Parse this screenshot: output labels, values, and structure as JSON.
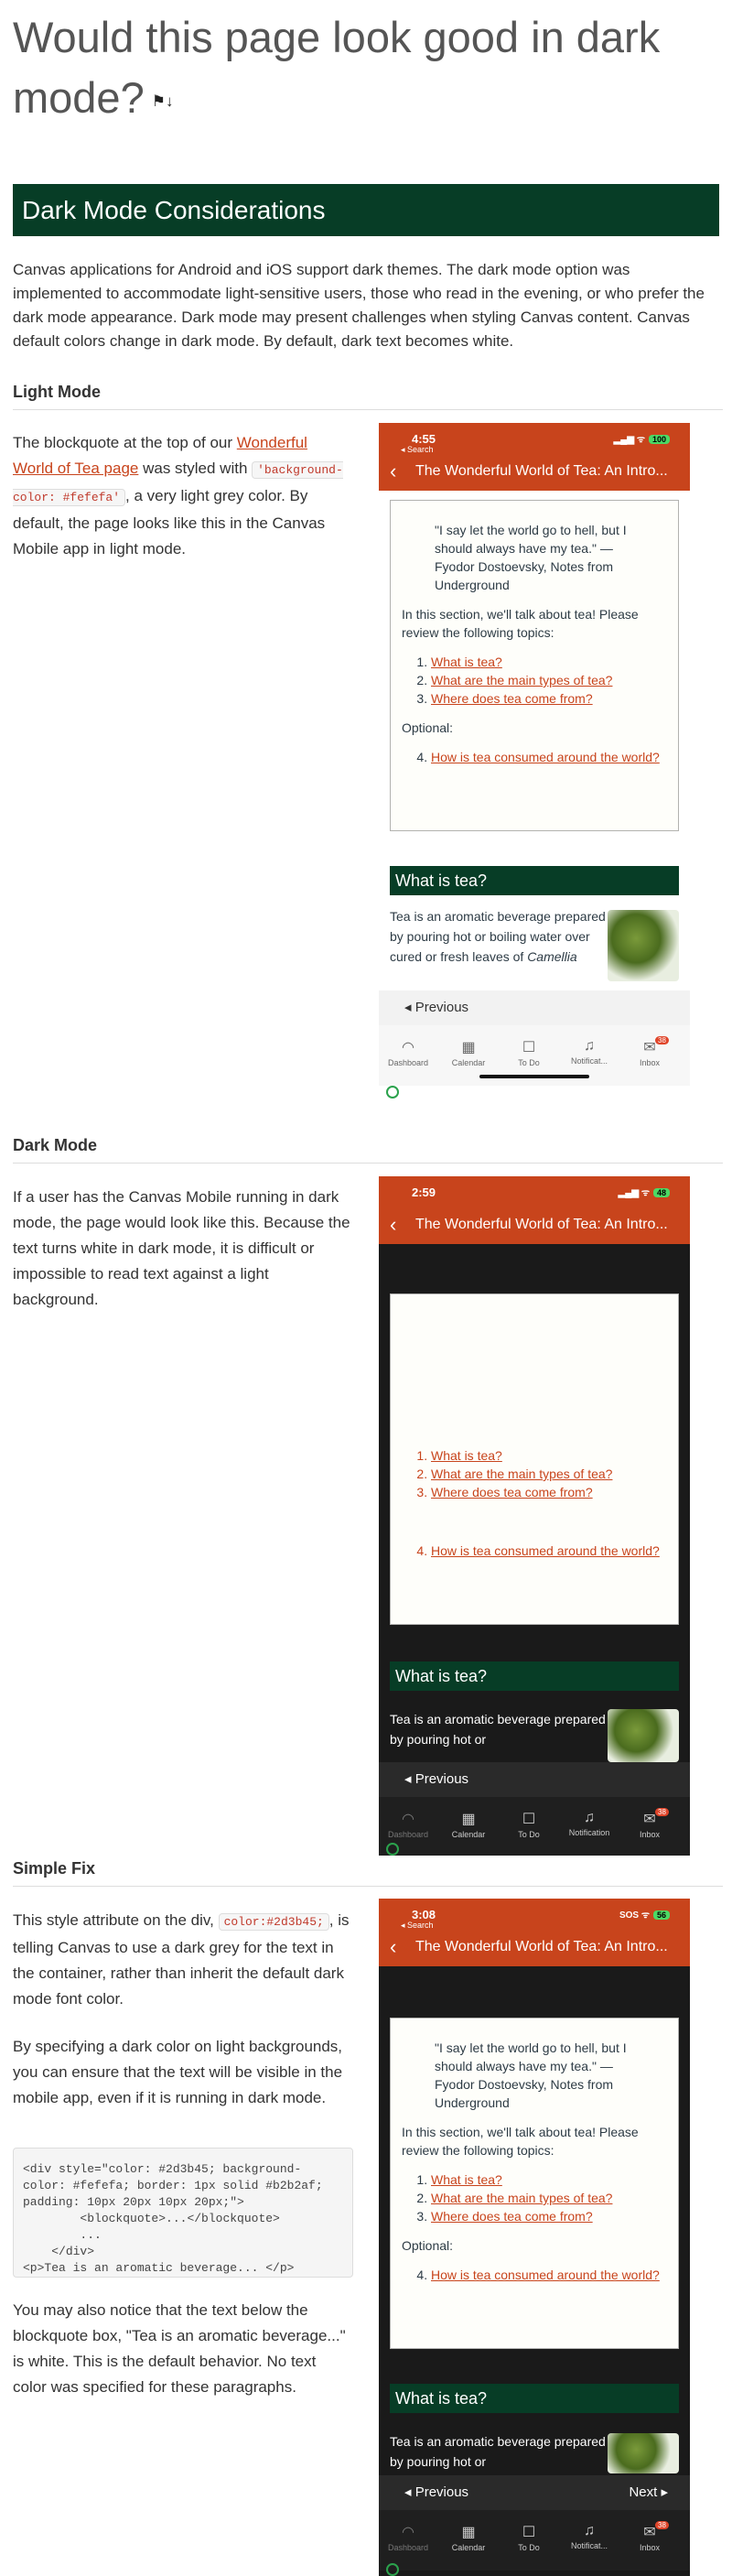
{
  "title": "Would this page look good in dark mode?",
  "banner": "Dark Mode Considerations",
  "intro": "Canvas applications for Android and iOS support dark themes. The dark mode option was implemented to accommodate light-sensitive users, those who read in the evening, or who prefer the dark mode appearance. Dark mode may present challenges when styling Canvas content. Canvas default colors change in dark mode. By default, dark text becomes white.",
  "light": {
    "heading": "Light Mode",
    "p1": "The blockquote at the top of our ",
    "link": "Wonderful World of Tea page",
    "p2": " was styled with ",
    "code": "'background-color: #fefefa'",
    "p3": ", a very light grey color. By default, the page looks like this in the Canvas Mobile app in light mode."
  },
  "dark": {
    "heading": "Dark Mode",
    "text": "If a user has the Canvas Mobile running in dark mode, the page would look like this. Because the text turns white in dark mode, it is difficult or impossible to read text against a light background."
  },
  "fix": {
    "heading": "Simple Fix",
    "p1a": "This style attribute on the div, ",
    "code": "color:#2d3b45;",
    "p1b": ", is telling Canvas to use a dark grey for the text in the container, rather than inherit the default dark mode font color.",
    "p2": "By specifying a dark color on light backgrounds, you can ensure that the text will be visible in the mobile app, even if it is running in dark mode.",
    "pre": "<div style=\"color: #2d3b45; background-color: #fefefa; border: 1px solid #b2b2af; padding: 10px 20px 10px 20px;\">\n        <blockquote>...</blockquote>\n        ...\n    </div>\n<p>Tea is an aromatic beverage... </p>",
    "p3": "You may also notice that the text below the blockquote box, \"Tea is an aromatic beverage...\" is white. This is the default behavior. No text color was specified for these paragraphs."
  },
  "phone": {
    "title": "The Wonderful World of Tea: An Intro...",
    "search": "◂ Search",
    "quote": "\"I say let the world go to hell, but I should always have my tea.\" — Fyodor Dostoevsky, Notes from Underground",
    "section": "In this section, we'll talk about tea! Please review the following topics:",
    "topics": [
      "What is tea?",
      "What are the main types of tea?",
      "Where does tea come from?"
    ],
    "optional": "Optional:",
    "topic4": "How is tea consumed around the world?",
    "what": "What is tea?",
    "tea_full": "Tea is an aromatic beverage prepared by pouring hot or boiling water over cured or fresh leaves of ",
    "tea_em": "Camellia",
    "tea_short": "Tea is an aromatic beverage prepared by pouring hot or",
    "prev": "◂  Previous",
    "next": "Next  ▸",
    "tabs": [
      "Dashboard",
      "Calendar",
      "To Do",
      "Notificat...",
      "Inbox"
    ],
    "tabs_dark": [
      "Dashboard",
      "Calendar",
      "To Do",
      "Notification",
      "Inbox"
    ],
    "badge": "38",
    "times": [
      "4:55",
      "2:59",
      "3:08"
    ],
    "bat": [
      "100",
      "48",
      "56"
    ],
    "sos": "SOS"
  },
  "colors": {
    "brand": "#073d26",
    "accent": "#c8441c",
    "dark_bg": "#1a1a1a",
    "quote_bg": "#fefefa"
  }
}
